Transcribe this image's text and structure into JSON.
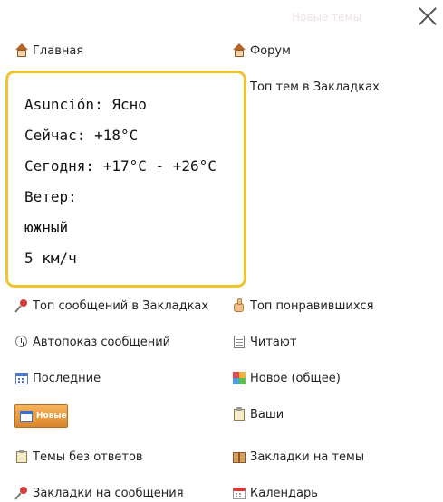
{
  "background_hint": "Новые темы",
  "menu": {
    "home": "Главная",
    "forum": "Форум",
    "top_topics_bookmarks": "Топ тем в Закладках",
    "top_posts_bookmarks": "Топ сообщений в Закладках",
    "top_liked": "Топ понравившихся",
    "autoshow": "Автопоказ сообщений",
    "reading": "Читают",
    "latest": "Последние",
    "new_general": "Новое (общее)",
    "new_button": "Новые",
    "yours": "Ваши",
    "unanswered": "Темы без ответов",
    "topic_bookmarks": "Закладки на темы",
    "post_bookmarks": "Закладки на сообщения",
    "calendar": "Календарь"
  },
  "weather": {
    "city_line": "Asunción: Ясно",
    "now_line": "Сейчас: +18°C",
    "today_line": "Сегодня: +17°C - +26°C",
    "wind_label": "Ветер:",
    "wind_dir": "южный",
    "wind_speed": "5 км/ч"
  },
  "colors": {
    "accent_border": "#f2c32a",
    "new_button": "#e8952f"
  }
}
